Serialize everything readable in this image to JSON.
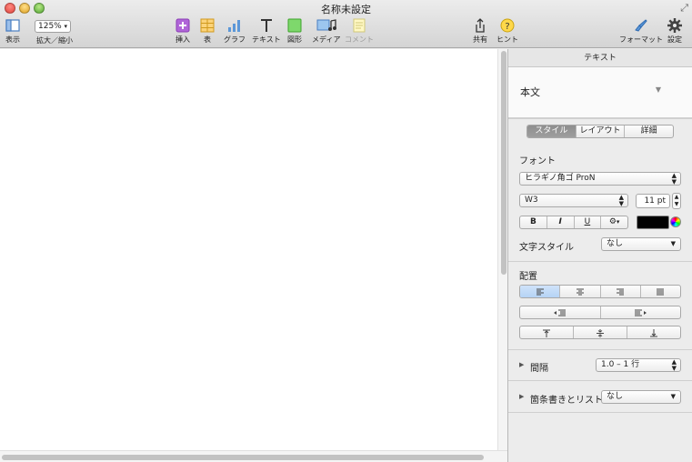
{
  "window": {
    "title": "名称未設定"
  },
  "toolbar": {
    "view_label": "表示",
    "zoom_value": "125%",
    "zoom_label": "拡大／縮小",
    "insert_label": "挿入",
    "table_label": "表",
    "chart_label": "グラフ",
    "text_label": "テキスト",
    "shape_label": "図形",
    "media_label": "メディア",
    "comment_label": "コメント",
    "share_label": "共有",
    "tips_label": "ヒント",
    "format_label": "フォーマット",
    "settings_label": "設定"
  },
  "sidebar": {
    "header": "テキスト",
    "paragraph_style": "本文",
    "tabs": [
      {
        "label": "スタイル",
        "active": true
      },
      {
        "label": "レイアウト",
        "active": false
      },
      {
        "label": "詳細",
        "active": false
      }
    ],
    "font_section": "フォント",
    "font_family": "ヒラギノ角ゴ ProN",
    "font_weight": "W3",
    "font_size": "11 pt",
    "bold": "B",
    "italic": "I",
    "underline": "U",
    "gear": "⚙",
    "text_color": "#000000",
    "char_style_label": "文字スタイル",
    "char_style_value": "なし",
    "alignment_section": "配置",
    "spacing_label": "間隔",
    "spacing_value": "1.0 – 1 行",
    "bullets_label": "箇条書きとリスト",
    "bullets_value": "なし"
  }
}
